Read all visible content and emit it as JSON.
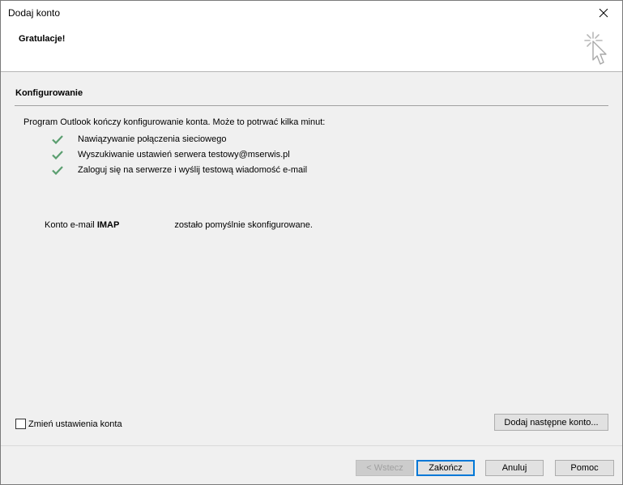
{
  "window": {
    "title": "Dodaj konto",
    "close_label": "×"
  },
  "header": {
    "title": "Gratulacje!",
    "icon": "sparkle-cursor-icon"
  },
  "section": {
    "title": "Konfigurowanie",
    "intro": "Program Outlook kończy konfigurowanie konta. Może to potrwać kilka minut:"
  },
  "steps": [
    {
      "label": "Nawiązywanie połączenia sieciowego",
      "status": "done"
    },
    {
      "label": "Wyszukiwanie ustawień serwera testowy@mserwis.pl",
      "status": "done"
    },
    {
      "label": "Zaloguj się na serwerze i wyślij testową wiadomość e-mail",
      "status": "done"
    }
  ],
  "result": {
    "prefix": "Konto e-mail ",
    "type": "IMAP",
    "suffix": "zostało pomyślnie skonfigurowane."
  },
  "options": {
    "change_settings_label": "Zmień ustawienia konta",
    "change_settings_checked": false,
    "add_another_label": "Dodaj następne konto..."
  },
  "footer": {
    "back_label": "< Wstecz",
    "finish_label": "Zakończ",
    "cancel_label": "Anuluj",
    "help_label": "Pomoc"
  },
  "colors": {
    "check": "#5a9e6f",
    "accent": "#0078d7"
  }
}
